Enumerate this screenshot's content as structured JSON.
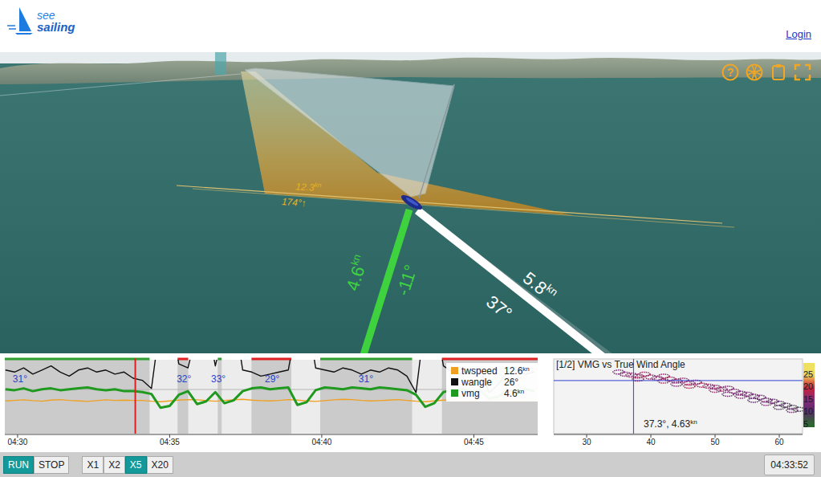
{
  "header": {
    "logo": {
      "line1": "see",
      "line2": "sailing"
    },
    "login": "Login"
  },
  "scene": {
    "toolbar": [
      {
        "kind": "help",
        "glyph": "?"
      },
      {
        "kind": "ball"
      },
      {
        "kind": "clipboard"
      },
      {
        "kind": "fullscreen"
      }
    ],
    "wind": {
      "speed": "12.3",
      "unit": "kn",
      "direction": "174°↑"
    },
    "vectors": [
      {
        "kind": "course",
        "speed": "4.6",
        "unit": "kn",
        "angle": "-11°",
        "color": "#3fd23f"
      },
      {
        "kind": "heading",
        "speed": "5.8",
        "unit": "kn",
        "angle": "37°",
        "color": "#ffffff"
      }
    ]
  },
  "timeline": {
    "t_min": 29.58,
    "t_max": 47.1,
    "start": 29.6,
    "step": 0.3,
    "ticks": [
      {
        "label": "04:30",
        "value": 30
      },
      {
        "label": "04:35",
        "value": 35
      },
      {
        "label": "04:40",
        "value": 40
      },
      {
        "label": "04:45",
        "value": 45
      }
    ],
    "cursor": 33.87,
    "tacks": [
      {
        "from": 34.34,
        "to": 35.26
      },
      {
        "from": 35.61,
        "to": 36.58
      },
      {
        "from": 36.71,
        "to": 37.69
      },
      {
        "from": 39.0,
        "to": 39.95
      },
      {
        "from": 42.97,
        "to": 43.95
      }
    ],
    "legs": [
      {
        "from": 29.58,
        "to": 34.34,
        "color": "#2e9e2e"
      },
      {
        "from": 35.26,
        "to": 35.61,
        "color": "#e02020"
      },
      {
        "from": 36.58,
        "to": 36.71,
        "color": "#2e9e2e"
      },
      {
        "from": 37.69,
        "to": 39.0,
        "color": "#e02020"
      },
      {
        "from": 39.95,
        "to": 42.97,
        "color": "#2e9e2e"
      },
      {
        "from": 43.95,
        "to": 47.1,
        "color": "#e02020"
      }
    ],
    "angles": [
      {
        "label": "31°",
        "t": 30.08
      },
      {
        "label": "32°",
        "t": 35.47
      },
      {
        "label": "33°",
        "t": 36.6
      },
      {
        "label": "29°",
        "t": 38.37
      },
      {
        "label": "31°",
        "t": 41.45
      }
    ],
    "series": [
      {
        "label": "twspeed",
        "value": "12.6",
        "unit": "kn",
        "color": "#f0a020",
        "min": 0,
        "max": 28,
        "values": [
          12.4,
          12.6,
          12.8,
          12.5,
          12.3,
          12.7,
          12.9,
          12.6,
          12.4,
          12.2,
          12.5,
          12.8,
          12.6,
          12.7,
          12.6,
          12.6,
          12.3,
          12.1,
          12.4,
          12.7,
          12.9,
          12.8,
          12.5,
          12.3,
          12.6,
          12.8,
          13.0,
          12.7,
          12.5,
          12.4,
          12.6,
          12.9,
          12.7,
          12.4,
          12.2,
          12.5,
          12.8,
          13.0,
          12.9,
          12.6,
          12.4,
          12.5,
          12.7,
          12.9,
          12.6,
          12.3,
          12.1,
          12.4,
          12.7,
          12.8,
          12.6,
          12.5,
          12.4,
          12.6,
          12.8,
          12.7,
          12.5,
          12.6,
          12.7
        ]
      },
      {
        "label": "wangle",
        "value": "26°",
        "unit": "",
        "color": "#111111",
        "min": 0,
        "max": 36,
        "values": [
          31,
          30,
          32,
          29,
          31,
          33,
          30,
          28,
          31,
          32,
          30,
          31,
          29,
          30,
          27,
          26,
          22,
          55,
          60,
          34,
          32,
          50,
          58,
          33,
          52,
          60,
          31,
          30,
          28,
          29,
          30,
          31,
          55,
          60,
          32,
          31,
          30,
          32,
          31,
          29,
          31,
          30,
          32,
          31,
          28,
          20,
          56,
          60,
          33,
          30,
          29,
          31,
          32,
          20,
          24,
          30,
          31,
          29,
          30
        ]
      },
      {
        "label": "vmg",
        "value": "4.6",
        "unit": "kn",
        "color": "#1f9a1f",
        "min": 0,
        "max": 8,
        "values": [
          4.8,
          4.7,
          4.9,
          4.6,
          4.8,
          4.9,
          4.7,
          4.8,
          4.9,
          5.0,
          4.8,
          4.7,
          4.8,
          4.6,
          4.6,
          4.5,
          4.3,
          2.8,
          3.0,
          4.2,
          4.6,
          3.2,
          3.5,
          4.5,
          3.3,
          3.6,
          4.6,
          4.9,
          5.0,
          4.8,
          4.9,
          5.0,
          3.1,
          3.4,
          4.7,
          5.0,
          4.9,
          4.8,
          5.0,
          4.9,
          4.8,
          5.0,
          4.9,
          4.8,
          4.7,
          4.2,
          2.9,
          3.3,
          4.5,
          4.7,
          4.8,
          4.6,
          4.7,
          3.8,
          4.0,
          4.6,
          4.7,
          4.8,
          4.6
        ]
      }
    ]
  },
  "polar": {
    "title": "[1/2] VMG vs True Wind Angle",
    "x": {
      "min": 24.875,
      "max": 63.625,
      "ticks": [
        {
          "label": "30",
          "value": 30
        },
        {
          "label": "40",
          "value": 40
        },
        {
          "label": "50",
          "value": 50
        },
        {
          "label": "60",
          "value": 60
        }
      ]
    },
    "y": {
      "min": 2.0,
      "max": 5.7
    },
    "colorbar": {
      "min": 3.7,
      "max": 29.5,
      "ticks": [
        {
          "label": "25",
          "value": 25
        },
        {
          "label": "20",
          "value": 20
        },
        {
          "label": "15",
          "value": 15
        },
        {
          "label": "10",
          "value": 10
        },
        {
          "label": "5",
          "value": 5
        }
      ]
    },
    "cursor": {
      "twa": 37.3,
      "vmg": 4.63,
      "readout": "37.3°, 4.63",
      "unit": "kn"
    },
    "points": [
      [
        35,
        5.05,
        14
      ],
      [
        36,
        4.95,
        15
      ],
      [
        37,
        4.9,
        16
      ],
      [
        38,
        4.85,
        15
      ],
      [
        39,
        4.95,
        17
      ],
      [
        40,
        4.8,
        16
      ],
      [
        41,
        4.75,
        15
      ],
      [
        42,
        4.85,
        16
      ],
      [
        43,
        4.7,
        17
      ],
      [
        44,
        4.6,
        15
      ],
      [
        45,
        4.65,
        16
      ],
      [
        46,
        4.5,
        16
      ],
      [
        47,
        4.55,
        15
      ],
      [
        48,
        4.4,
        17
      ],
      [
        49,
        4.35,
        16
      ],
      [
        50,
        4.3,
        15
      ],
      [
        51,
        4.2,
        16
      ],
      [
        52,
        4.25,
        14
      ],
      [
        53,
        4.1,
        15
      ],
      [
        54,
        4.0,
        13
      ],
      [
        55,
        3.95,
        14
      ],
      [
        56,
        3.85,
        12
      ],
      [
        57,
        3.8,
        13
      ],
      [
        58,
        3.65,
        11
      ],
      [
        59,
        3.6,
        12
      ],
      [
        60,
        3.5,
        10
      ],
      [
        61,
        3.4,
        9
      ],
      [
        62,
        3.3,
        8
      ],
      [
        63,
        3.2,
        8
      ],
      [
        38,
        4.7,
        18
      ],
      [
        42,
        4.6,
        17
      ],
      [
        46,
        4.35,
        18
      ],
      [
        50,
        4.15,
        16
      ],
      [
        54,
        3.85,
        15
      ],
      [
        58,
        3.5,
        14
      ],
      [
        62,
        3.15,
        13
      ],
      [
        44,
        4.45,
        14
      ],
      [
        52,
        3.95,
        12
      ],
      [
        56,
        3.65,
        10
      ],
      [
        60,
        3.3,
        9
      ]
    ]
  },
  "controls": {
    "playback": [
      {
        "label": "RUN",
        "selected": true
      },
      {
        "label": "STOP",
        "selected": false
      }
    ],
    "speed": [
      {
        "label": "X1",
        "selected": false
      },
      {
        "label": "X2",
        "selected": false
      },
      {
        "label": "X5",
        "selected": true
      },
      {
        "label": "X20",
        "selected": false
      }
    ],
    "clock": "04:33:52"
  }
}
